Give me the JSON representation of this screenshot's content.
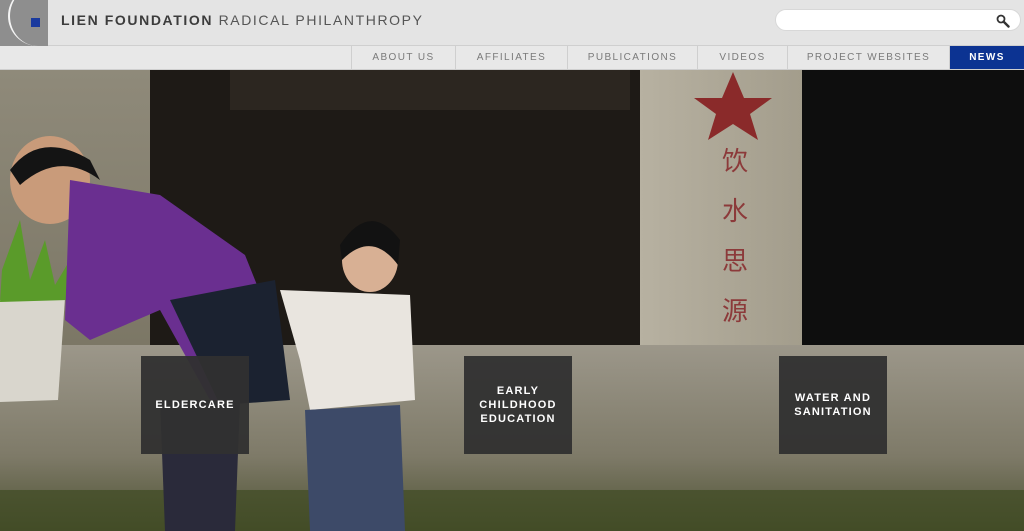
{
  "brand": {
    "bold": "LIEN FOUNDATION",
    "light": " RADICAL PHILANTHROPY"
  },
  "search": {
    "placeholder": "",
    "value": ""
  },
  "nav": {
    "items": [
      {
        "label": "ABOUT US"
      },
      {
        "label": "AFFILIATES"
      },
      {
        "label": "PUBLICATIONS"
      },
      {
        "label": "VIDEOS"
      },
      {
        "label": "PROJECT WEBSITES"
      },
      {
        "label": "NEWS"
      }
    ]
  },
  "hero": {
    "calligraphy": "饮水思源",
    "tiles": [
      {
        "label": "ELDERCARE"
      },
      {
        "label": "EARLY CHILDHOOD EDUCATION"
      },
      {
        "label": "WATER AND SANITATION"
      }
    ]
  },
  "colors": {
    "nav_active": "#0c3392",
    "logo_square": "#1a3a9e",
    "tile_bg": "#303030"
  }
}
